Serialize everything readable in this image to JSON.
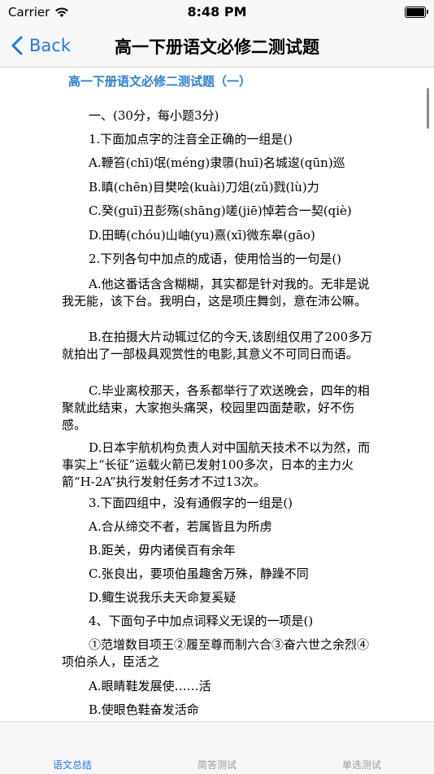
{
  "status_bar": {
    "carrier": "Carrier",
    "time": "8:48 PM"
  },
  "nav": {
    "back_label": "Back",
    "title": "高一下册语文必修二测试题"
  },
  "document": {
    "title": "高一下册语文必修二测试题（一）",
    "paragraphs": [
      "一、(30分，每小题3分)",
      "1.下面加点字的注音全正确的一组是()",
      "A.鞭笞(chī)氓(méng)隶隳(huī)名城逡(qūn)巡",
      "B.瞋(chēn)目樊哙(kuài)刀俎(zǔ)戮(lù)力",
      "C.癸(guī)丑彭殇(shāng)嗟(jiē)悼若合一契(qiè)",
      "D.田畴(chóu)山岫(yu)熹(xī)微东皋(gāo)",
      "2.下列各句中加点的成语，使用恰当的一句是()",
      "A.他这番话含含糊糊，其实都是针对我的。无非是说我无能，该下台。我明白，这是项庄舞剑，意在沛公嘛。",
      "B.在拍摄大片动辄过亿的今天,该剧组仅用了200多万就拍出了一部极具观赏性的电影,其意义不可同日而语。",
      "C.毕业离校那天，各系都举行了欢送晚会，四年的相聚就此结束，大家抱头痛哭，校园里四面楚歌，好不伤感。",
      "D.日本宇航机构负责人对中国航天技术不以为然，而事实上“长征”运载火箭已发射100多次，日本的主力火箭“H-2A”执行发射任务才不过13次。",
      "3.下面四组中，没有通假字的一组是()",
      "A.合从缔交不者，若属皆且为所虏",
      "B.距关，毋内诸侯百有余年",
      "C.张良出，要项伯虽趣舍万殊，静躁不同",
      "D.鲰生说我乐夫天命复奚疑",
      "4、下面句子中加点词释义无误的一项是()",
      "①范增数目项王②履至尊而制六合③奋六世之余烈④项伯杀人，臣活之",
      "A.眼睛鞋发展使……活",
      "B.使眼色鞋奋发活命"
    ]
  },
  "tabs": [
    {
      "label": "语文总结",
      "active": true
    },
    {
      "label": "简答测试",
      "active": false
    },
    {
      "label": "单选测试",
      "active": false
    }
  ],
  "colors": {
    "accent": "#1a7ae6",
    "doc_title": "#2f7fd3",
    "inactive_tab": "#999999"
  }
}
